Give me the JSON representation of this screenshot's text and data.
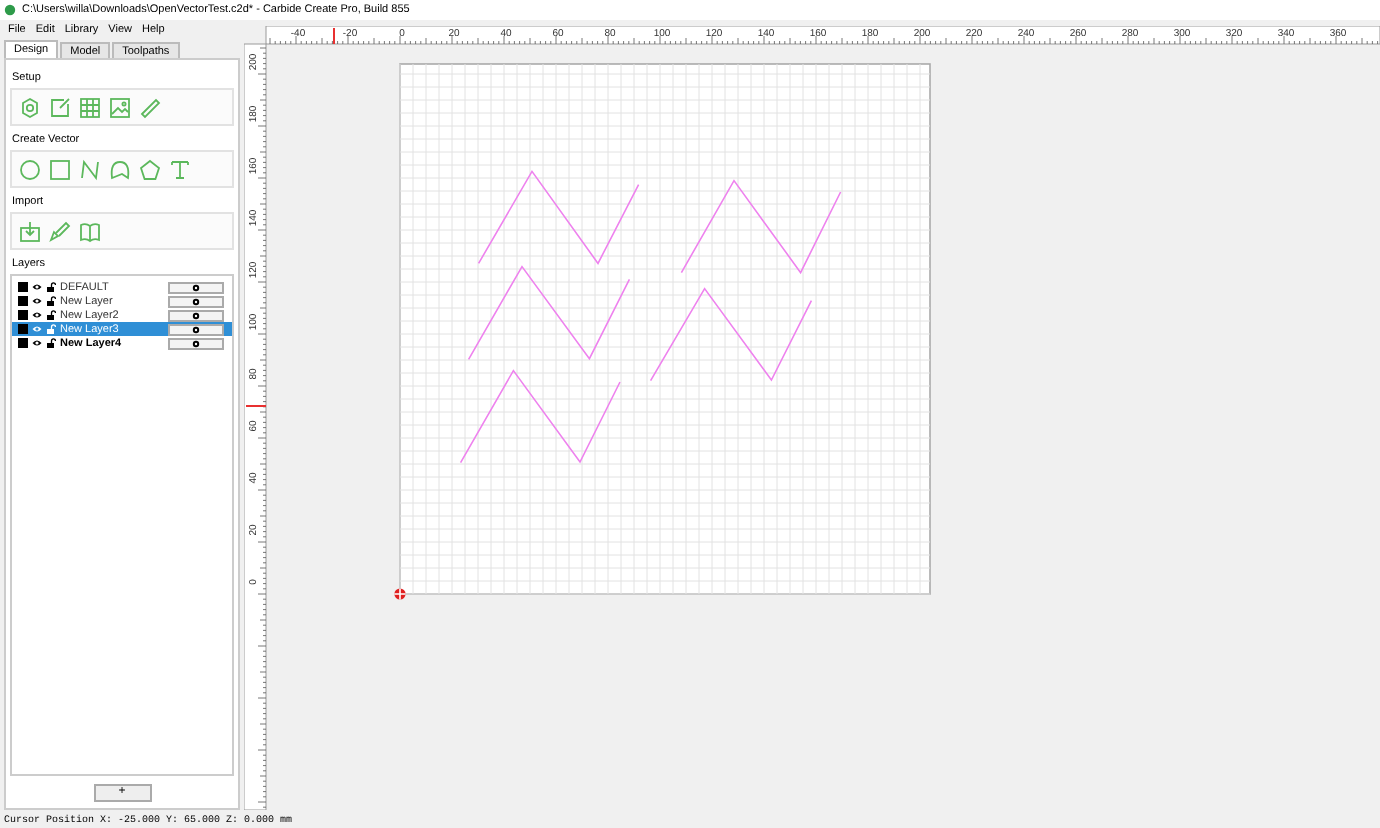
{
  "window": {
    "title": "C:\\Users\\willa\\Downloads\\OpenVectorTest.c2d* - Carbide Create Pro, Build 855"
  },
  "menu": [
    "File",
    "Edit",
    "Library",
    "View",
    "Help"
  ],
  "tabs": [
    {
      "label": "Design",
      "selected": true
    },
    {
      "label": "Model",
      "selected": false
    },
    {
      "label": "Toolpaths",
      "selected": false
    }
  ],
  "sections": [
    {
      "title": "Setup",
      "tools": [
        {
          "kind": "gear"
        },
        {
          "kind": "edit"
        },
        {
          "kind": "grid"
        },
        {
          "kind": "image"
        },
        {
          "kind": "ruler"
        }
      ]
    },
    {
      "title": "Create Vector",
      "tools": [
        {
          "kind": "circle"
        },
        {
          "kind": "rectangle"
        },
        {
          "kind": "curve"
        },
        {
          "kind": "polyline"
        },
        {
          "kind": "pentagon"
        },
        {
          "kind": "text"
        }
      ]
    },
    {
      "title": "Import",
      "tools": [
        {
          "kind": "import"
        },
        {
          "kind": "shapes"
        },
        {
          "kind": "book"
        }
      ]
    }
  ],
  "layers_title": "Layers",
  "layers": [
    {
      "name": "DEFAULT",
      "color": "#000000",
      "selected": false,
      "active": false
    },
    {
      "name": "New Layer",
      "color": "#000000",
      "selected": false,
      "active": false
    },
    {
      "name": "New Layer2",
      "color": "#000000",
      "selected": false,
      "active": false
    },
    {
      "name": "New Layer3",
      "color": "#000000",
      "selected": true,
      "active": false
    },
    {
      "name": "New Layer4",
      "color": "#000000",
      "selected": false,
      "active": true
    }
  ],
  "add_layer_button": "+",
  "top_ruler": [
    "-40",
    "-20",
    "0",
    "20",
    "40",
    "60",
    "80",
    "100",
    "120",
    "140",
    "160",
    "180",
    "200",
    "220",
    "240",
    "260",
    "280",
    "300",
    "320",
    "340",
    "360"
  ],
  "left_ruler": [
    "200",
    "180",
    "160",
    "140",
    "120",
    "100",
    "80",
    "60",
    "40",
    "20",
    "0"
  ],
  "status_bar": "Cursor Position X: -25.000 Y: 65.000 Z: 0.000 mm"
}
